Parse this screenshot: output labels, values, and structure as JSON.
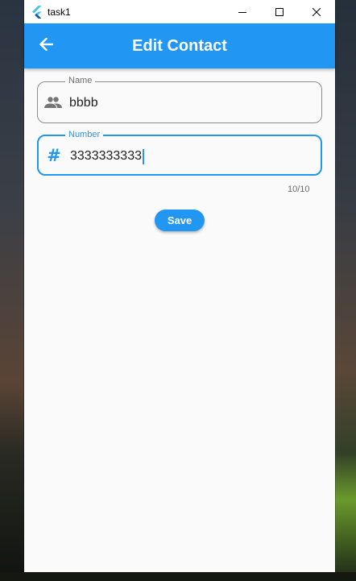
{
  "window": {
    "title": "task1",
    "icons": {
      "logo": "flutter-logo-icon",
      "minimize": "minimize-icon",
      "maximize": "maximize-icon",
      "close": "close-icon"
    }
  },
  "appbar": {
    "title": "Edit Contact",
    "back_icon": "arrow-back-icon",
    "color": "#2196f3"
  },
  "form": {
    "name": {
      "label": "Name",
      "value": "bbbb",
      "icon": "people-icon"
    },
    "number": {
      "label": "Number",
      "value": "3333333333",
      "icon": "hash-icon",
      "icon_glyph": "#",
      "counter": "10/10"
    },
    "save_label": "Save"
  },
  "colors": {
    "accent": "#2196f3",
    "page_background": "#fafafa",
    "outline_inactive": "#8c8c8c"
  }
}
